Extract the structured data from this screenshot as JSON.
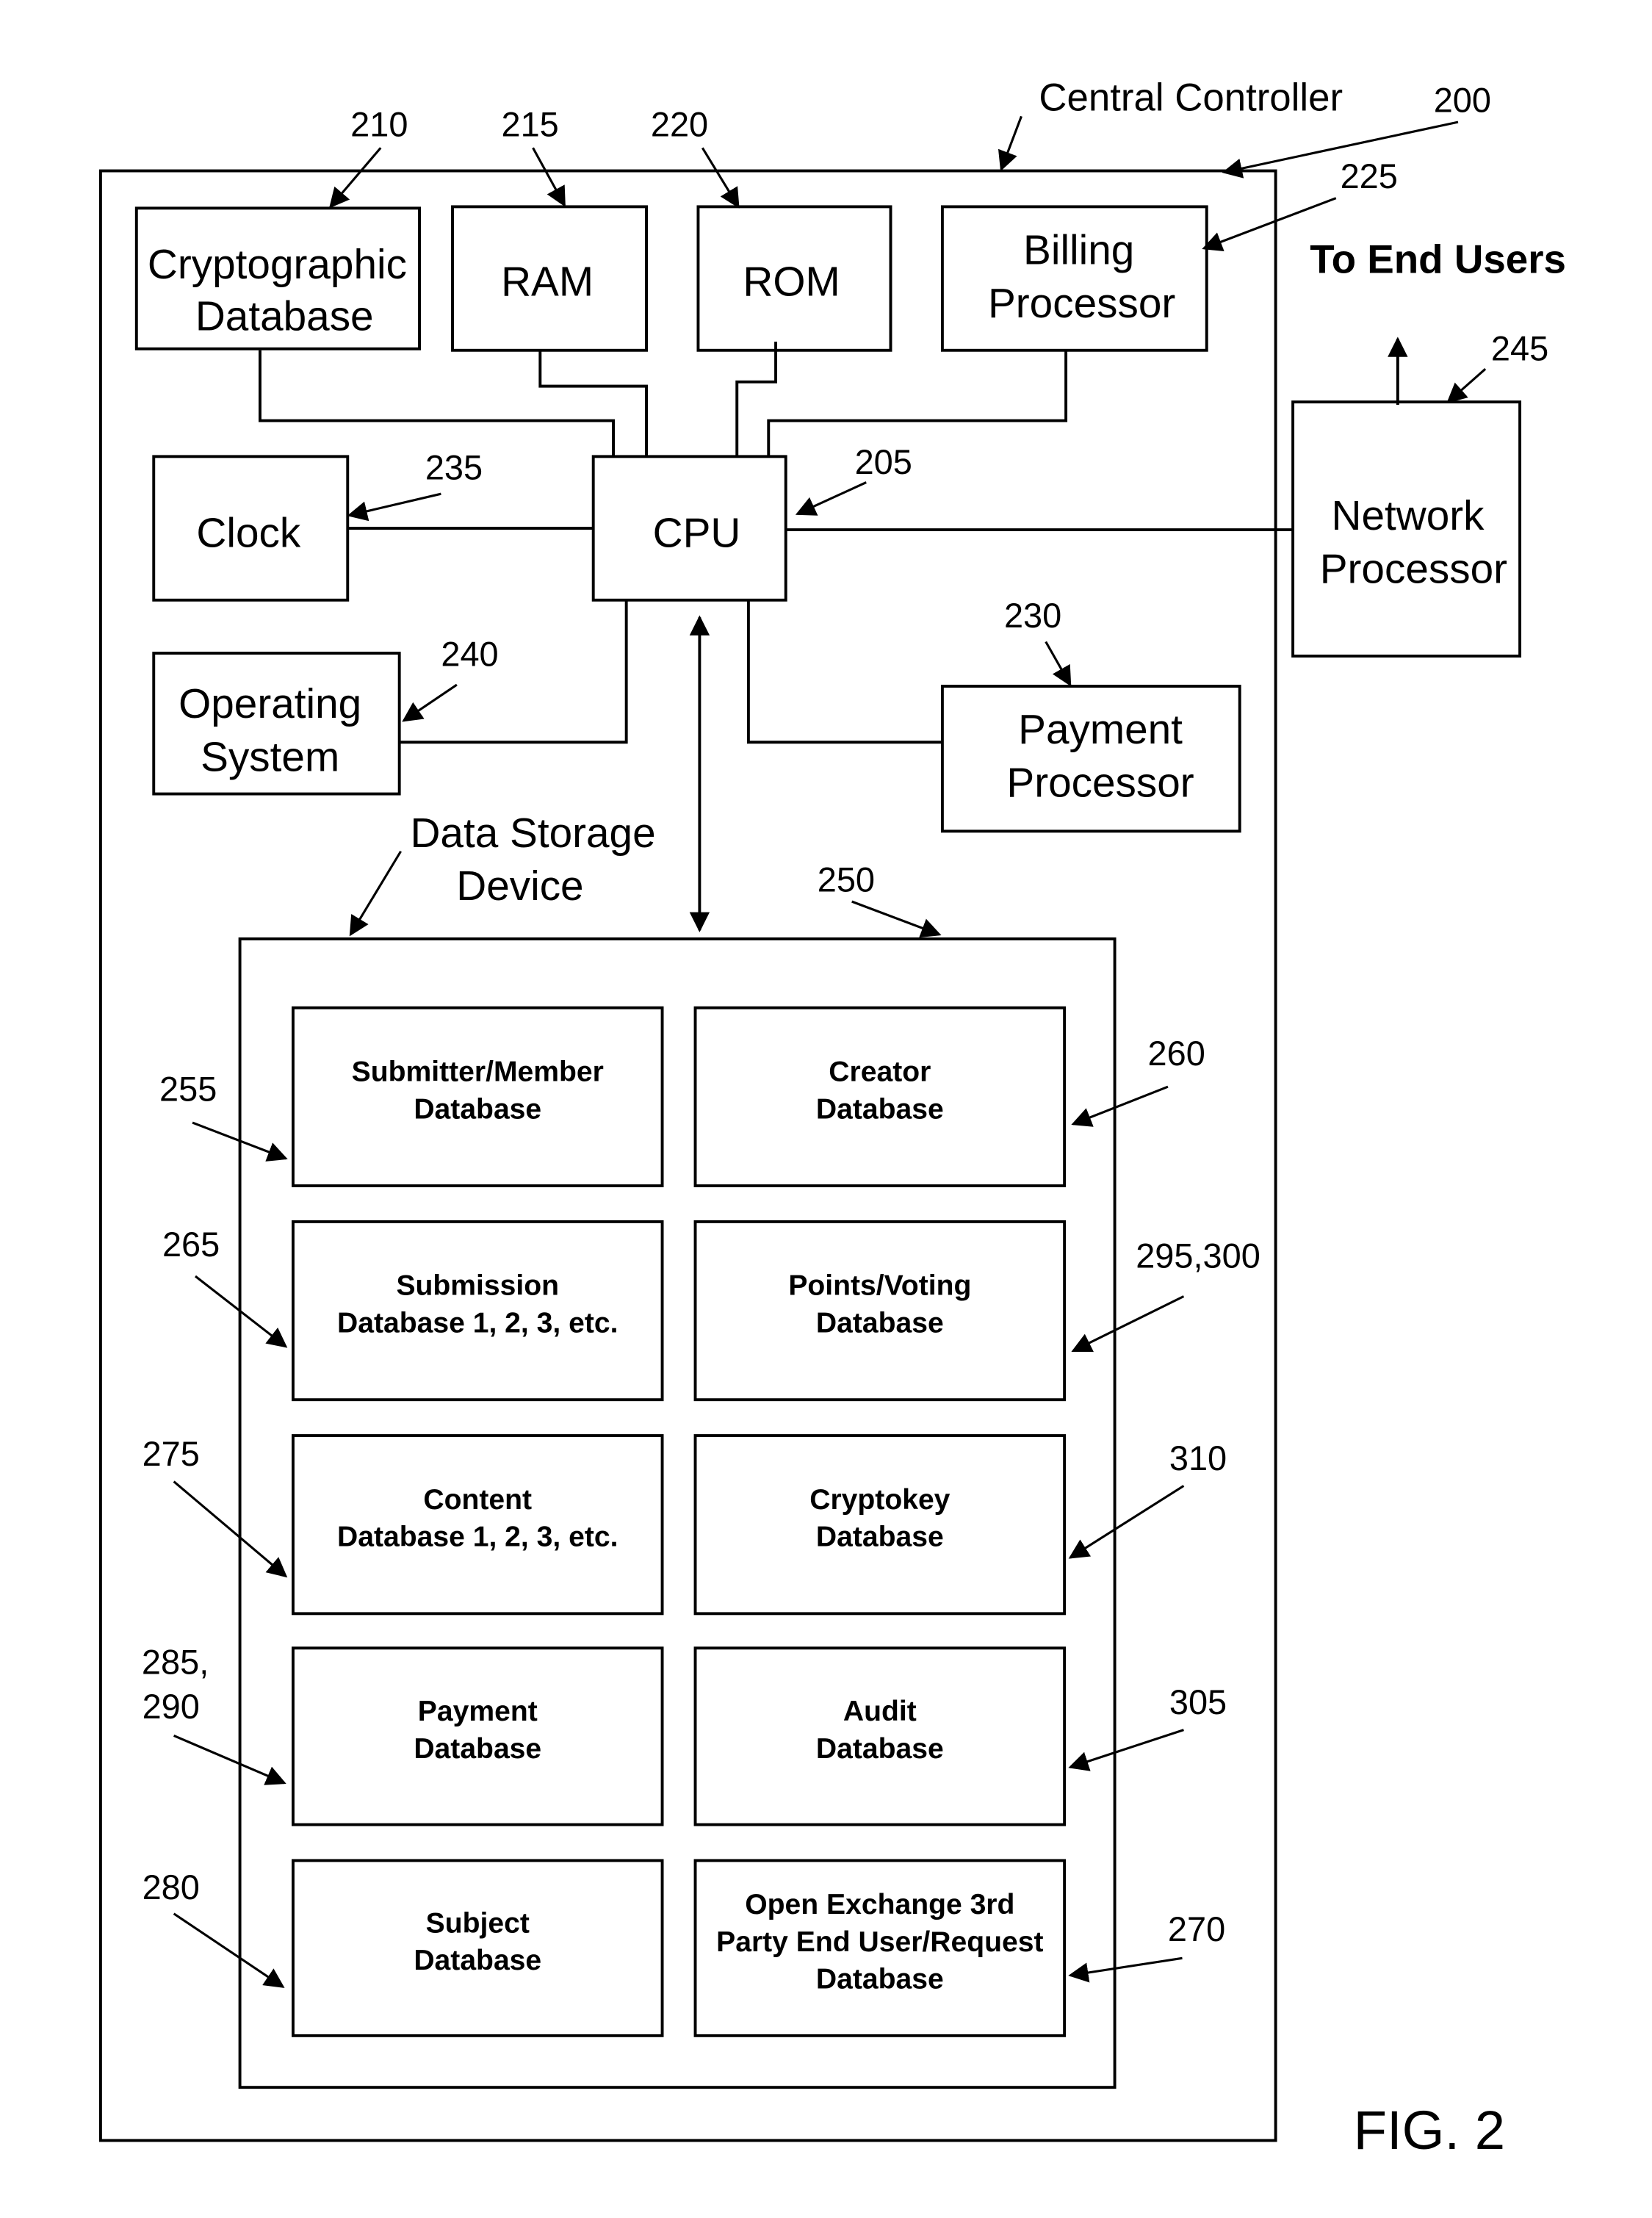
{
  "figure_label": "FIG. 2",
  "central_controller": {
    "label": "Central Controller",
    "ref": "200"
  },
  "to_end_users_label": "To End Users",
  "components": {
    "cryptographic_database": {
      "lines": [
        "Cryptographic",
        "Database"
      ],
      "ref": "210"
    },
    "ram": {
      "lines": [
        "RAM"
      ],
      "ref": "215"
    },
    "rom": {
      "lines": [
        "ROM"
      ],
      "ref": "220"
    },
    "billing_processor": {
      "lines": [
        "Billing",
        "Processor"
      ],
      "ref": "225"
    },
    "cpu": {
      "lines": [
        "CPU"
      ],
      "ref": "205"
    },
    "clock": {
      "lines": [
        "Clock"
      ],
      "ref": "235"
    },
    "operating_system": {
      "lines": [
        "Operating",
        "System"
      ],
      "ref": "240"
    },
    "payment_processor": {
      "lines": [
        "Payment",
        "Processor"
      ],
      "ref": "230"
    },
    "network_processor": {
      "lines": [
        "Network",
        "Processor"
      ],
      "ref": "245"
    }
  },
  "data_storage_device": {
    "label_lines": [
      "Data Storage",
      "Device"
    ],
    "ref": "250",
    "databases": [
      {
        "lines": [
          "Submitter/Member",
          "Database"
        ],
        "ref": "255"
      },
      {
        "lines": [
          "Creator",
          "Database"
        ],
        "ref": "260"
      },
      {
        "lines": [
          "Submission",
          "Database 1, 2, 3, etc."
        ],
        "ref": "265"
      },
      {
        "lines": [
          "Points/Voting",
          "Database"
        ],
        "ref": "295,300"
      },
      {
        "lines": [
          "Content",
          "Database 1, 2, 3, etc."
        ],
        "ref": "275"
      },
      {
        "lines": [
          "Cryptokey",
          "Database"
        ],
        "ref": "310"
      },
      {
        "lines": [
          "Payment",
          "Database"
        ],
        "ref_lines": [
          "285,",
          "290"
        ]
      },
      {
        "lines": [
          "Audit",
          "Database"
        ],
        "ref": "305"
      },
      {
        "lines": [
          "Subject",
          "Database"
        ],
        "ref": "280"
      },
      {
        "lines": [
          "Open Exchange 3rd",
          "Party End User/Request",
          "Database"
        ],
        "ref": "270"
      }
    ]
  }
}
